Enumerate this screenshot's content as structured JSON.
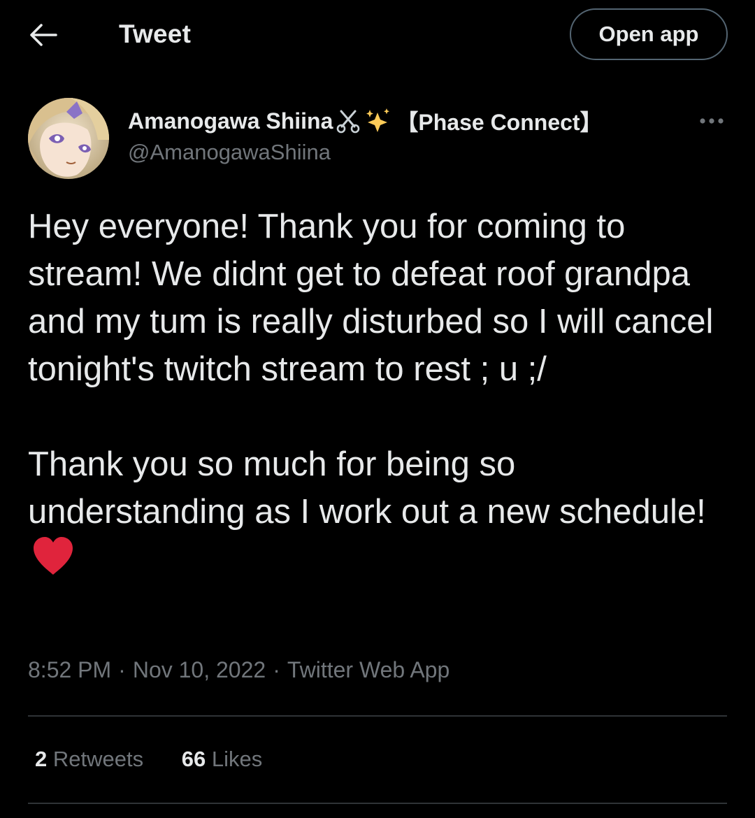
{
  "header": {
    "title": "Tweet",
    "open_app_label": "Open app",
    "back_icon": "arrow-left-icon"
  },
  "author": {
    "display_name": "Amanogawa Shiina",
    "name_emojis": [
      "scissors-icon",
      "sparkles-icon"
    ],
    "affiliation": "【Phase Connect】",
    "handle": "@AmanogawaShiina"
  },
  "tweet": {
    "paragraph1": "Hey everyone! Thank you for coming to stream! We didnt get to defeat roof grandpa and my tum is really disturbed so I will cancel tonight's twitch stream to rest ; u ;/",
    "paragraph2": "Thank you so much for being so understanding as I work out a new schedule!",
    "trailing_emoji": "red-heart-icon"
  },
  "meta": {
    "time": "8:52 PM",
    "separator": "·",
    "date": "Nov 10, 2022",
    "source": "Twitter Web App"
  },
  "stats": {
    "retweets_count": "2",
    "retweets_label": "Retweets",
    "likes_count": "66",
    "likes_label": "Likes"
  },
  "colors": {
    "background": "#000000",
    "text_primary": "#e7e9ea",
    "text_secondary": "#71767b",
    "divider": "#2f3336",
    "heart": "#e0243c"
  }
}
